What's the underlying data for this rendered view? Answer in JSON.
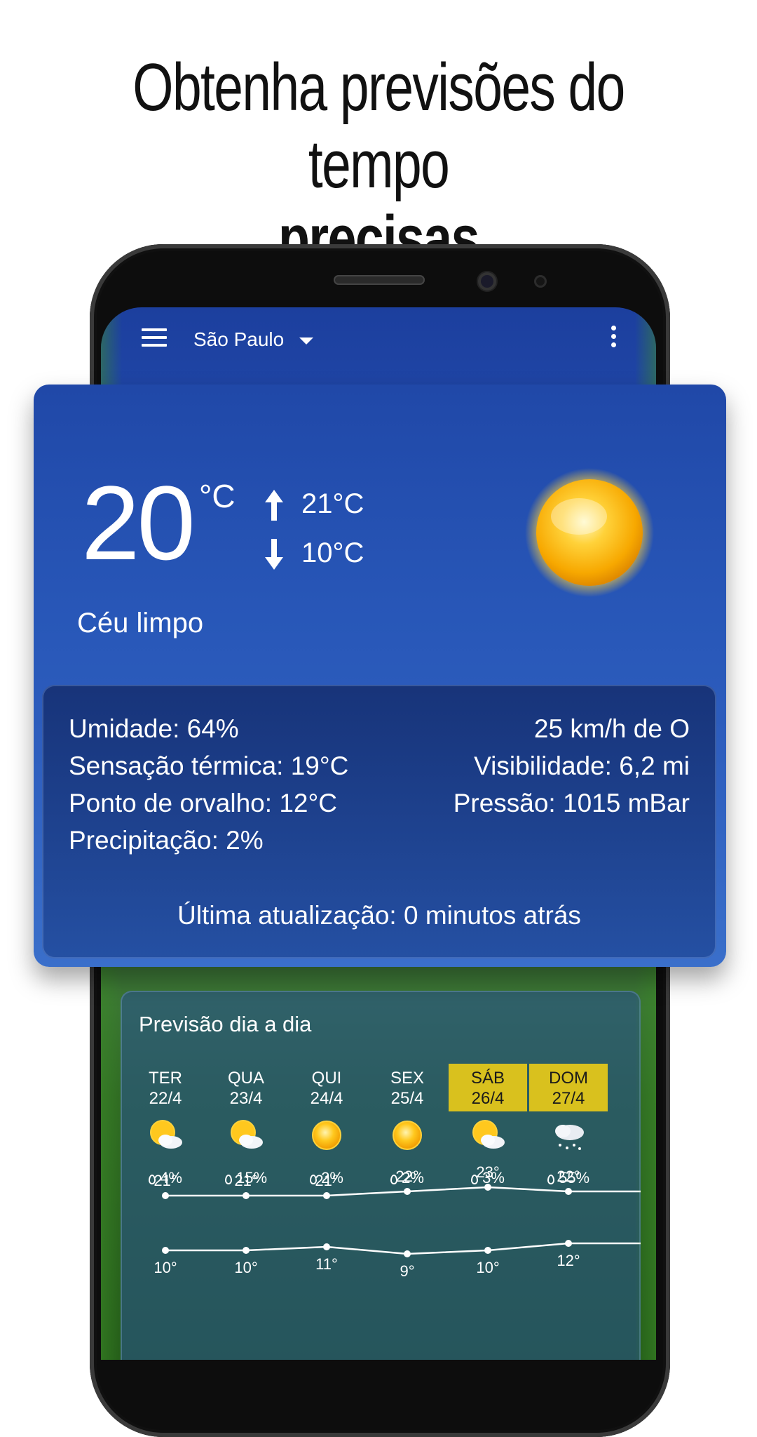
{
  "headline": {
    "line1": "Obtenha previsões do tempo",
    "line2": "precisas"
  },
  "appbar": {
    "city": "São Paulo"
  },
  "current": {
    "temperature": "20",
    "unit": "°C",
    "high": "21°C",
    "low": "10°C",
    "condition": "Céu limpo",
    "icon": "sun-icon"
  },
  "details": {
    "left": [
      "Umidade: 64%",
      "Sensação térmica: 19°C",
      "Ponto de orvalho: 12°C",
      "Precipitação: 2%"
    ],
    "right": [
      "25 km/h de O",
      "Visibilidade: 6,2 mi",
      "Pressão: 1015 mBar"
    ],
    "updated": "Última atualização: 0 minutos atrás"
  },
  "forecast": {
    "title": "Previsão dia a dia",
    "days": [
      {
        "day": "TER",
        "date": "22/4",
        "icon": "partly-cloudy-icon",
        "rain": "4%",
        "high": "21°",
        "low": "10°",
        "highlight": false
      },
      {
        "day": "QUA",
        "date": "23/4",
        "icon": "partly-cloudy-icon",
        "rain": "15%",
        "high": "21°",
        "low": "10°",
        "highlight": false
      },
      {
        "day": "QUI",
        "date": "24/4",
        "icon": "sun-icon",
        "rain": "2%",
        "high": "21°",
        "low": "11°",
        "highlight": false
      },
      {
        "day": "SEX",
        "date": "25/4",
        "icon": "sun-icon",
        "rain": "2%",
        "high": "22°",
        "low": "9°",
        "highlight": false
      },
      {
        "day": "SÁB",
        "date": "26/4",
        "icon": "partly-cloudy-icon",
        "rain": "3%",
        "high": "23°",
        "low": "10°",
        "highlight": true
      },
      {
        "day": "DOM",
        "date": "27/4",
        "icon": "snow-cloud-icon",
        "rain": "55%",
        "high": "22°",
        "low": "12°",
        "highlight": true
      }
    ],
    "high_values": [
      21,
      21,
      21,
      22,
      23,
      22
    ],
    "low_values": [
      10,
      10,
      11,
      9,
      10,
      12
    ]
  },
  "colors": {
    "highlight": "#d9c11e",
    "card": "#2857b8"
  }
}
